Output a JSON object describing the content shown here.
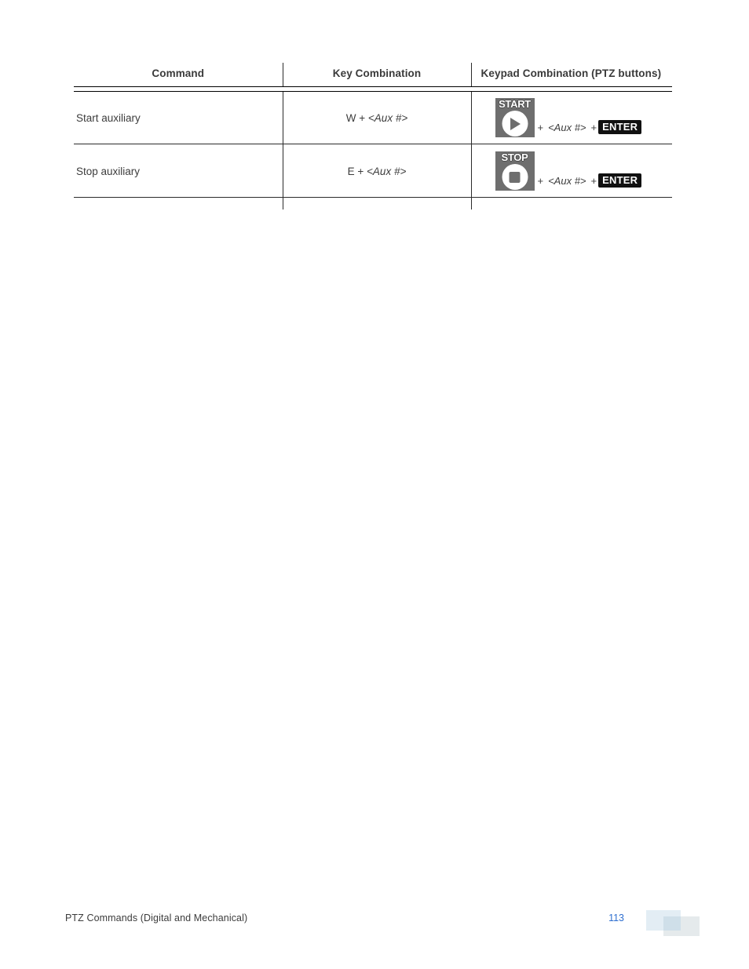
{
  "document": {
    "table": {
      "headers": [
        {
          "label": "Command",
          "align": "center"
        },
        {
          "label": "Key Combination",
          "align": "center"
        },
        {
          "label": "Keypad Combination (PTZ buttons)",
          "align": "left"
        }
      ],
      "rows": [
        {
          "command": "Start auxiliary",
          "key_combination": {
            "prefix": "W + ",
            "variable": "<Aux #>"
          },
          "keypad_combination": {
            "button_label": "START",
            "button_glyph": "play-icon",
            "separator_1": "+ ",
            "variable": "<Aux #>",
            "separator_2": " + ",
            "enter_label": "ENTER"
          }
        },
        {
          "command": "Stop auxiliary",
          "key_combination": {
            "prefix": "E + ",
            "variable": "<Aux #>"
          },
          "keypad_combination": {
            "button_label": "STOP",
            "button_glyph": "stop-square-icon",
            "separator_1": "+ ",
            "variable": "<Aux #>",
            "separator_2": " + ",
            "enter_label": "ENTER"
          }
        }
      ]
    },
    "footer": {
      "section_title": "PTZ  Commands (Digital and Mechanical)",
      "page_number": "113"
    },
    "colors": {
      "page_background": "#ffffff",
      "body_text": "#3c3c3c",
      "rule": "#2b2b2b",
      "ptz_button_gray": "#6e6e6e",
      "enter_badge": "#111111",
      "page_number_blue": "#2f6fd0",
      "deco_light_blue": "#e3edf4",
      "deco_mid_blue": "#cfdfe9"
    }
  }
}
